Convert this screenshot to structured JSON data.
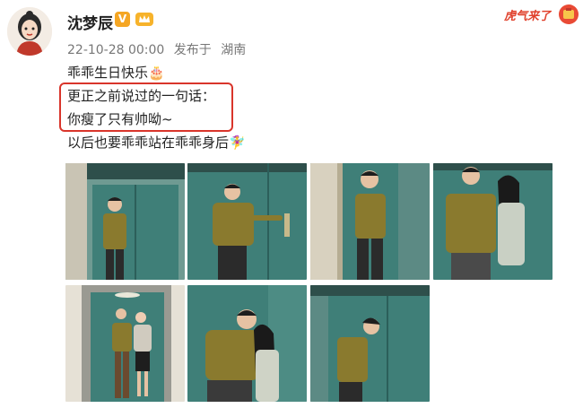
{
  "post": {
    "username": "沈梦辰",
    "verified_badge": "V",
    "timestamp": "22-10-28 00:00",
    "published_from": "发布于",
    "location": "湖南",
    "festive_badge_text": "虎气来了",
    "lines": [
      "乖乖生日快乐🎂",
      "更正之前说过的一句话：",
      "你瘦了只有帅呦~",
      "以后也要乖乖站在乖乖身后🧚‍♀️"
    ]
  },
  "photos": [
    {
      "name": "photo-1",
      "people": 1
    },
    {
      "name": "photo-2",
      "people": 1
    },
    {
      "name": "photo-3",
      "people": 1
    },
    {
      "name": "photo-4",
      "people": 2
    },
    {
      "name": "photo-5",
      "people": 2
    },
    {
      "name": "photo-6",
      "people": 2
    },
    {
      "name": "photo-7",
      "people": 1
    }
  ],
  "colors": {
    "highlight": "#d9352b",
    "elevator_teal": "#3f7f78",
    "shirt_olive": "#8a7a2e",
    "badge_orange": "#f5a623"
  }
}
